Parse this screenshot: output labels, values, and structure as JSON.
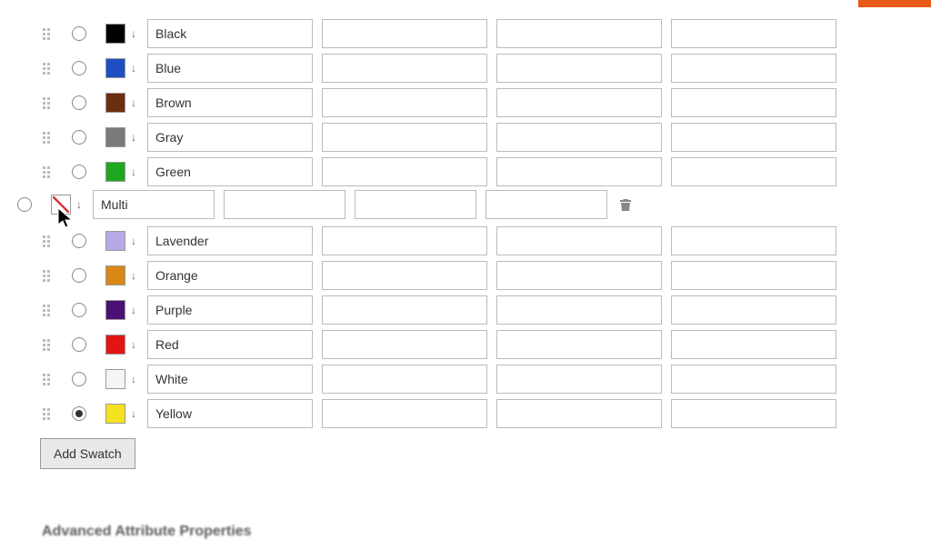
{
  "buttons": {
    "add_swatch": "Add Swatch"
  },
  "bottom_heading": "Advanced Attribute Properties",
  "default_row_index": 11,
  "dragging_row_index": 5,
  "swatches": [
    {
      "name": "Black",
      "color": "#000000",
      "nocolor": false
    },
    {
      "name": "Blue",
      "color": "#1e4fc2",
      "nocolor": false
    },
    {
      "name": "Brown",
      "color": "#6b2f10",
      "nocolor": false
    },
    {
      "name": "Gray",
      "color": "#7a7a7a",
      "nocolor": false
    },
    {
      "name": "Green",
      "color": "#1fa71f",
      "nocolor": false
    },
    {
      "name": "Multi",
      "color": "#ffffff",
      "nocolor": true
    },
    {
      "name": "Lavender",
      "color": "#b9a8e6",
      "nocolor": false
    },
    {
      "name": "Orange",
      "color": "#d98817",
      "nocolor": false
    },
    {
      "name": "Purple",
      "color": "#4b1073",
      "nocolor": false
    },
    {
      "name": "Red",
      "color": "#e31414",
      "nocolor": false
    },
    {
      "name": "White",
      "color": "#f5f5f5",
      "nocolor": false
    },
    {
      "name": "Yellow",
      "color": "#f5e21f",
      "nocolor": false
    }
  ]
}
